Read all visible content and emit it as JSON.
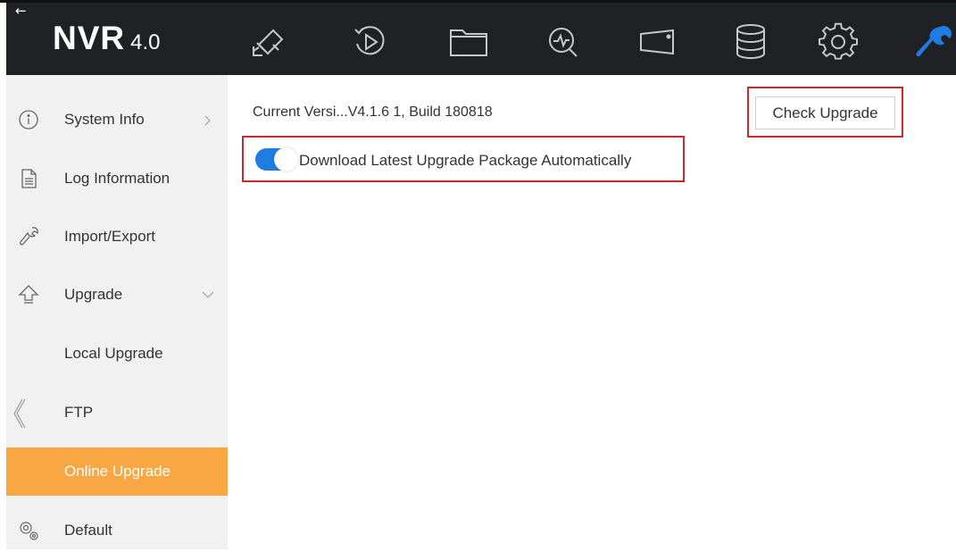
{
  "header": {
    "back_icon": "back-arrow-icon",
    "brand_name": "NVR",
    "brand_version": "4.0",
    "nav_icons": [
      "live-view-camera-icon",
      "playback-icon",
      "file-folder-icon",
      "smart-analysis-icon",
      "screen-display-icon",
      "storage-icon",
      "settings-gear-icon",
      "maintenance-wrench-icon"
    ],
    "active_nav_color": "#1e7ce3"
  },
  "sidebar": {
    "items": [
      {
        "label": "System Info",
        "icon": "info-icon",
        "expand": "chevron-right"
      },
      {
        "label": "Log Information",
        "icon": "document-icon"
      },
      {
        "label": "Import/Export",
        "icon": "wrench-icon"
      },
      {
        "label": "Upgrade",
        "icon": "upgrade-arrow-icon",
        "expand": "chevron-down"
      },
      {
        "label": "Local Upgrade"
      },
      {
        "label": "FTP"
      },
      {
        "label": "Online Upgrade",
        "active": true
      },
      {
        "label": "Default",
        "icon": "gears-icon"
      }
    ],
    "active_color": "#f9a743",
    "collapse_icon": "collapse-chevron-left-icon"
  },
  "main": {
    "version_text": "Current Versi...V4.1.6 1, Build 180818",
    "check_upgrade_label": "Check Upgrade",
    "auto_download_label": "Download Latest Upgrade Package Automatically",
    "auto_download_enabled": true,
    "highlight_color": "#d0262d"
  }
}
